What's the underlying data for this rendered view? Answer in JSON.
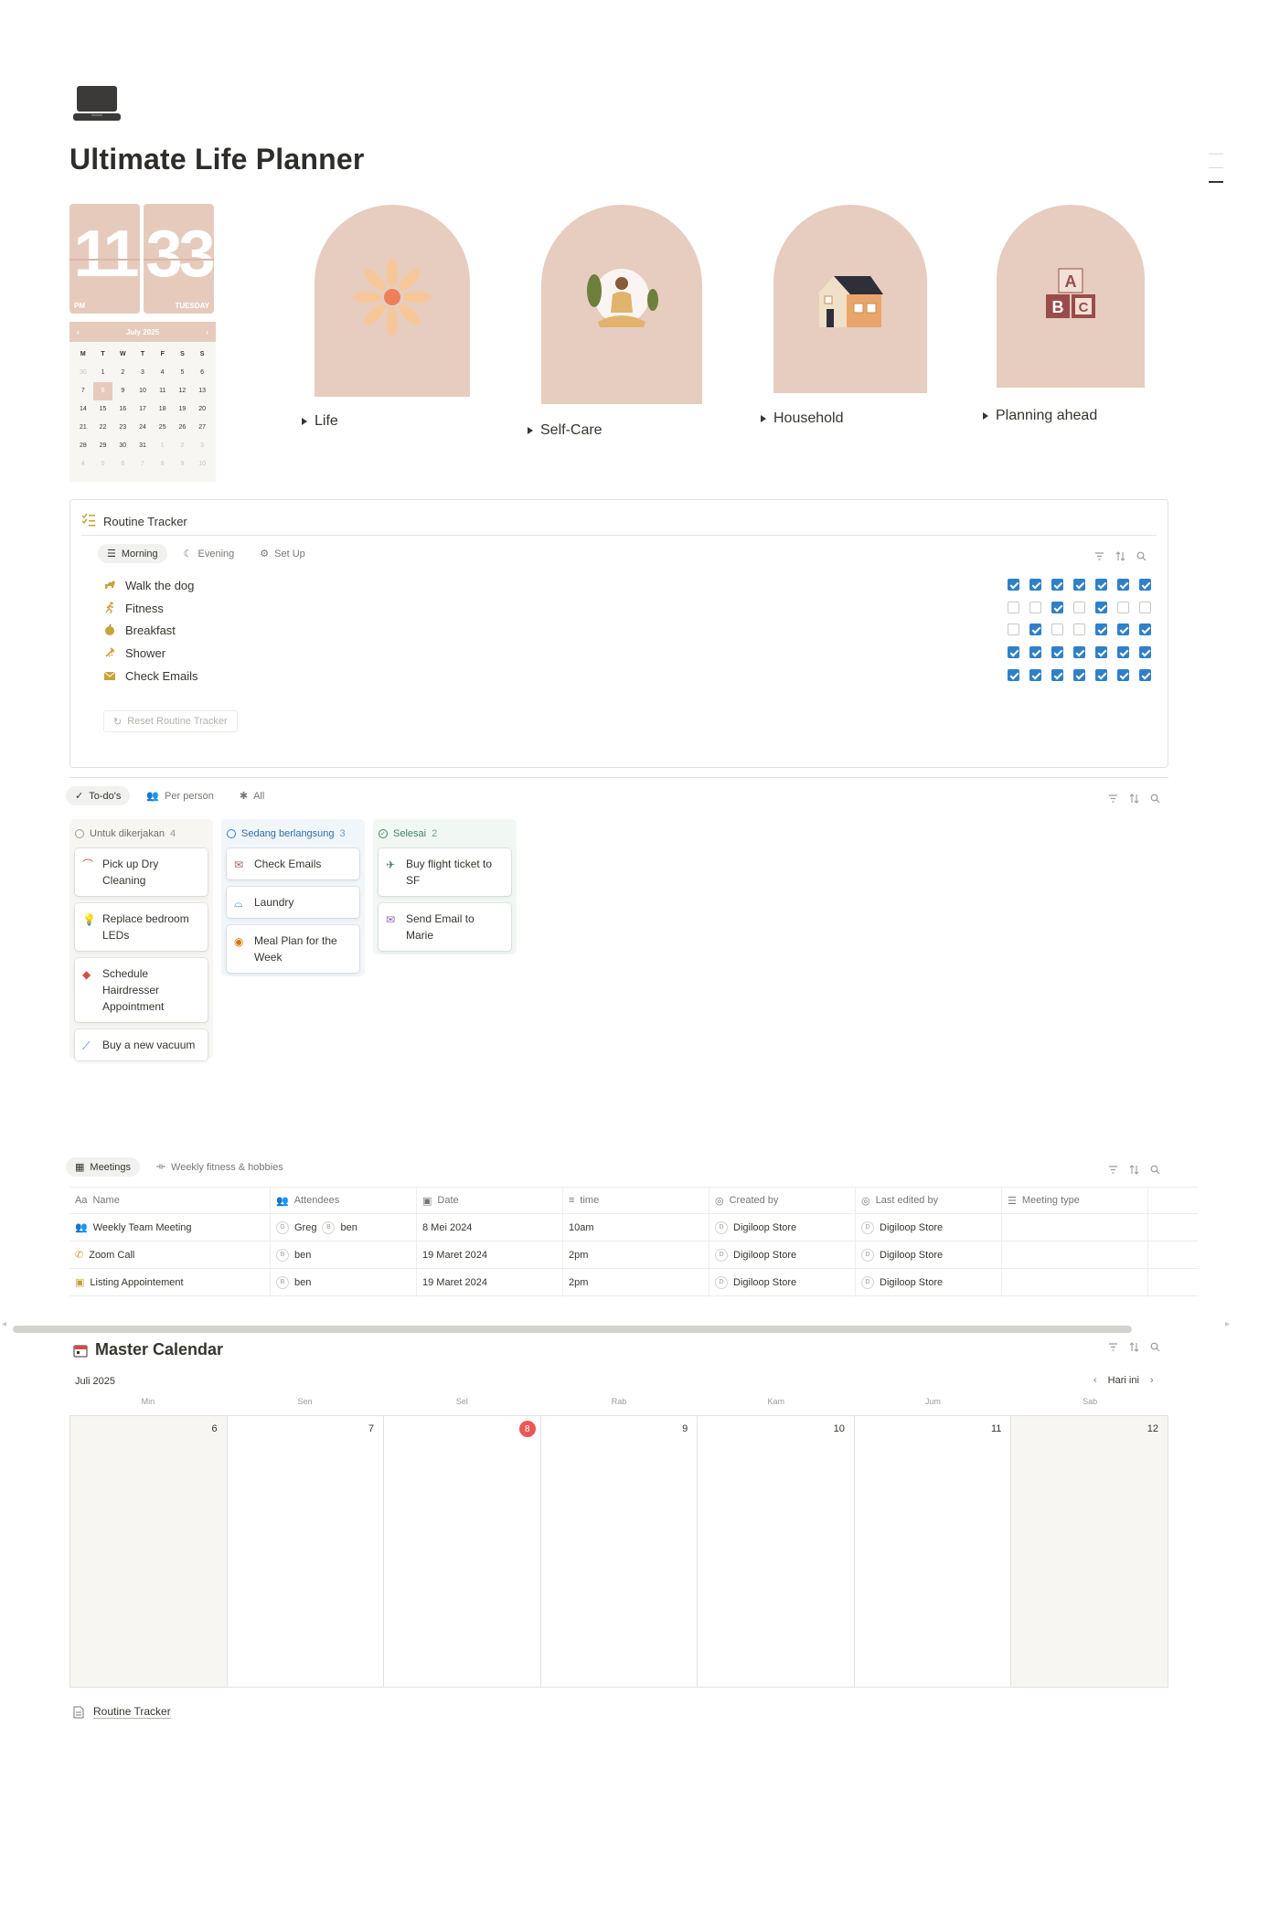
{
  "page": {
    "title": "Ultimate Life Planner"
  },
  "clock": {
    "hour": "11",
    "minute": "33",
    "ampm": "PM",
    "weekday": "TUESDAY"
  },
  "minical": {
    "month": "July 2025",
    "headers": [
      "M",
      "T",
      "W",
      "T",
      "F",
      "S",
      "S"
    ],
    "weeks": [
      [
        "30",
        "1",
        "2",
        "3",
        "4",
        "5",
        "6"
      ],
      [
        "7",
        "8",
        "9",
        "10",
        "11",
        "12",
        "13"
      ],
      [
        "14",
        "15",
        "16",
        "17",
        "18",
        "19",
        "20"
      ],
      [
        "21",
        "22",
        "23",
        "24",
        "25",
        "26",
        "27"
      ],
      [
        "28",
        "29",
        "30",
        "31",
        "1",
        "2",
        "3"
      ],
      [
        "4",
        "5",
        "6",
        "7",
        "8",
        "9",
        "10"
      ]
    ]
  },
  "sections": [
    {
      "label": "Life",
      "icon": "flower-icon"
    },
    {
      "label": "Self-Care",
      "icon": "meditation-icon"
    },
    {
      "label": "Household",
      "icon": "house-icon"
    },
    {
      "label": "Planning ahead",
      "icon": "abc-blocks-icon"
    }
  ],
  "routine": {
    "title": "Routine Tracker",
    "tabs": [
      "Morning",
      "Evening",
      "Set Up"
    ],
    "rows": [
      {
        "label": "Walk the dog",
        "icon": "dog-icon",
        "checks": [
          true,
          true,
          true,
          true,
          true,
          true,
          true
        ]
      },
      {
        "label": "Fitness",
        "icon": "running-icon",
        "checks": [
          false,
          false,
          true,
          false,
          true,
          false,
          false
        ]
      },
      {
        "label": "Breakfast",
        "icon": "apple-icon",
        "checks": [
          false,
          true,
          false,
          false,
          true,
          true,
          true
        ]
      },
      {
        "label": "Shower",
        "icon": "shower-icon",
        "checks": [
          true,
          true,
          true,
          true,
          true,
          true,
          true
        ]
      },
      {
        "label": "Check Emails",
        "icon": "mail-icon",
        "checks": [
          true,
          true,
          true,
          true,
          true,
          true,
          true
        ]
      }
    ],
    "reset_label": "Reset Routine Tracker"
  },
  "todos": {
    "tabs": [
      "To-do's",
      "Per person",
      "All"
    ],
    "columns": [
      {
        "name": "Untuk dikerjakan",
        "count": "4",
        "cards": [
          "Pick up Dry Cleaning",
          "Replace bedroom LEDs",
          "Schedule Hairdresser Appointment",
          "Buy a new vacuum"
        ]
      },
      {
        "name": "Sedang berlangsung",
        "count": "3",
        "cards": [
          "Check Emails",
          "Laundry",
          "Meal Plan for the Week"
        ]
      },
      {
        "name": "Selesai",
        "count": "2",
        "cards": [
          "Buy flight ticket to SF",
          "Send Email to Marie"
        ]
      }
    ]
  },
  "meetings": {
    "tabs": [
      "Meetings",
      "Weekly fitness & hobbies"
    ],
    "headers": [
      "Name",
      "Attendees",
      "Date",
      "time",
      "Created by",
      "Last edited by",
      "Meeting type"
    ],
    "rows": [
      {
        "name": "Weekly Team Meeting",
        "att1": "Greg",
        "att2": "ben",
        "date": "8 Mei 2024",
        "time": "10am",
        "created": "Digiloop Store",
        "edited": "Digiloop Store"
      },
      {
        "name": "Zoom Call",
        "att1": "ben",
        "att2": "",
        "date": "19 Maret 2024",
        "time": "2pm",
        "created": "Digiloop Store",
        "edited": "Digiloop Store"
      },
      {
        "name": "Listing Appointement",
        "att1": "ben",
        "att2": "",
        "date": "19 Maret 2024",
        "time": "2pm",
        "created": "Digiloop Store",
        "edited": "Digiloop Store"
      }
    ]
  },
  "calendar": {
    "title": "Master Calendar",
    "month": "Juli 2025",
    "today_label": "Hari ini",
    "weekdays": [
      "Min",
      "Sen",
      "Sel",
      "Rab",
      "Kam",
      "Jum",
      "Sab"
    ],
    "dates": [
      "6",
      "7",
      "8",
      "9",
      "10",
      "11",
      "12"
    ]
  },
  "footer": {
    "link": "Routine Tracker"
  }
}
